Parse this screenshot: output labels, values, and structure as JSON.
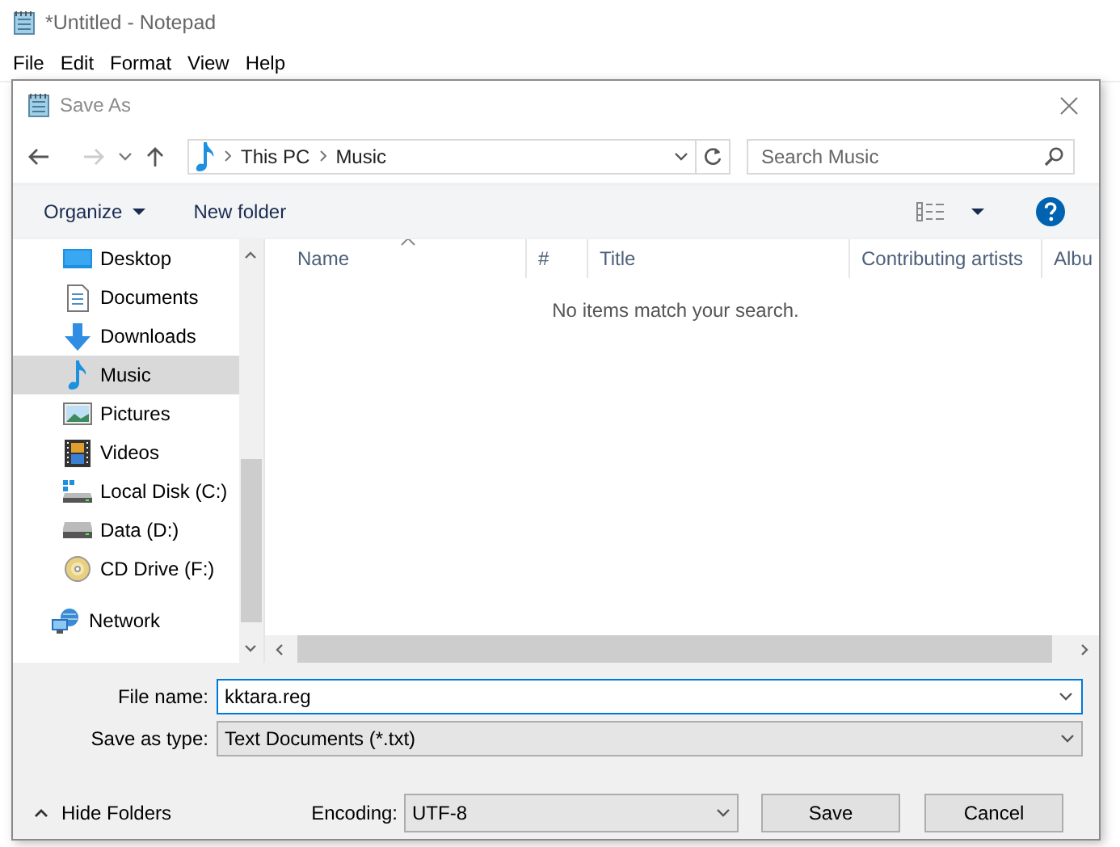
{
  "notepad": {
    "title": "*Untitled - Notepad",
    "menu": [
      "File",
      "Edit",
      "Format",
      "View",
      "Help"
    ]
  },
  "dialog": {
    "title": "Save As",
    "breadcrumb": [
      "This PC",
      "Music"
    ],
    "search": {
      "placeholder": "Search Music"
    },
    "toolbar": {
      "organize": "Organize",
      "new_folder": "New folder"
    },
    "sidebar": {
      "items": [
        {
          "label": "Desktop",
          "kind": "desktop",
          "selected": false
        },
        {
          "label": "Documents",
          "kind": "documents",
          "selected": false
        },
        {
          "label": "Downloads",
          "kind": "downloads",
          "selected": false
        },
        {
          "label": "Music",
          "kind": "music",
          "selected": true
        },
        {
          "label": "Pictures",
          "kind": "pictures",
          "selected": false
        },
        {
          "label": "Videos",
          "kind": "videos",
          "selected": false
        },
        {
          "label": "Local Disk (C:)",
          "kind": "system-drive",
          "selected": false
        },
        {
          "label": "Data (D:)",
          "kind": "drive",
          "selected": false
        },
        {
          "label": "CD Drive (F:)",
          "kind": "cd",
          "selected": false
        }
      ],
      "network": {
        "label": "Network",
        "selected": false
      }
    },
    "table": {
      "columns": [
        "Name",
        "#",
        "Title",
        "Contributing artists",
        "Albu"
      ],
      "empty_message": "No items match your search."
    },
    "file_name": {
      "label": "File name:",
      "value": "kktara.reg"
    },
    "save_as_type": {
      "label": "Save as type:",
      "value": "Text Documents (*.txt)"
    },
    "hide_folders": "Hide Folders",
    "encoding": {
      "label": "Encoding:",
      "value": "UTF-8"
    },
    "buttons": [
      "Save",
      "Cancel"
    ]
  }
}
